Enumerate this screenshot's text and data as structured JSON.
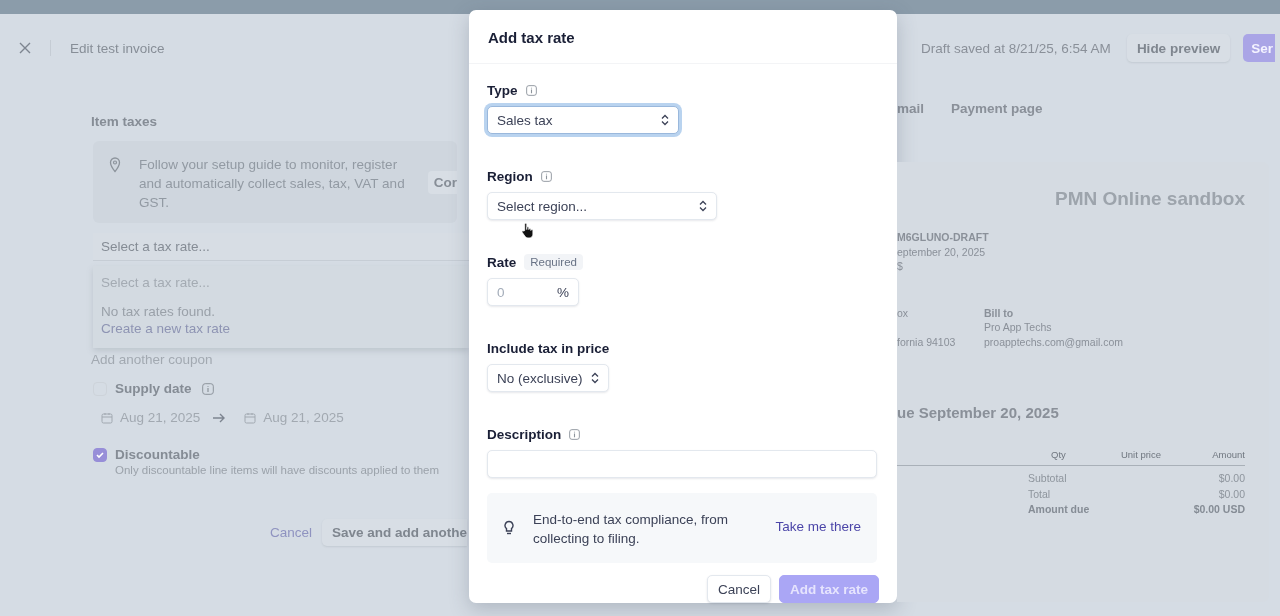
{
  "header": {
    "title": "Edit test invoice",
    "draft_status": "Draft saved at 8/21/25, 6:54 AM",
    "buttons": [
      {
        "label": "Hide preview",
        "kind": "secondary"
      },
      {
        "label": "Ser",
        "kind": "primary"
      }
    ]
  },
  "item_form": {
    "section_title": "Item taxes",
    "notice": {
      "text": "Follow your setup guide to monitor, register and automatically collect sales, tax, VAT and GST.",
      "button": "Cor"
    },
    "tax_select": {
      "placeholder": "Select a tax rate..."
    },
    "dropdown": {
      "search_placeholder": "Select a tax rate...",
      "empty_text": "No tax rates found.",
      "create_link": "Create a new tax rate"
    },
    "add_coupon": "Add another coupon",
    "supply_date": {
      "label": "Supply date",
      "checked": false,
      "start": "Aug 21, 2025",
      "end": "Aug 21, 2025"
    },
    "discountable": {
      "label": "Discountable",
      "checked": true,
      "hint": "Only discountable line items will have discounts applied to them"
    },
    "actions": {
      "cancel": "Cancel",
      "save": "Save and add anothe"
    }
  },
  "dialog": {
    "title": "Add tax rate",
    "fields": [
      {
        "kind": "select",
        "label": "Type",
        "info": true,
        "value": "Sales tax",
        "focused": true
      },
      {
        "kind": "select",
        "label": "Region",
        "info": true,
        "value": "Select region...",
        "focused": false
      },
      {
        "kind": "rate",
        "label": "Rate",
        "info": false,
        "badge": "Required",
        "placeholder": "0",
        "suffix": "%"
      },
      {
        "kind": "select",
        "label": "Include tax in price",
        "info": false,
        "value": "No (exclusive)",
        "focused": false
      },
      {
        "kind": "text",
        "label": "Description",
        "info": true
      }
    ],
    "notice": {
      "text": "End-to-end tax compliance, from collecting to filing.",
      "link": "Take me there"
    },
    "buttons": [
      {
        "label": "Cancel",
        "kind": "secondary",
        "disabled": false
      },
      {
        "label": "Add tax rate",
        "kind": "primary",
        "disabled": true
      }
    ]
  },
  "preview": {
    "tabs": [
      "mail",
      "Payment page"
    ],
    "invoice": {
      "company": "PMN Online sandbox",
      "meta": [
        "M6GLUNO-DRAFT",
        "eptember 20, 2025",
        "$"
      ],
      "from_lines": [
        "ox",
        "fornia 94103"
      ],
      "bill_to": {
        "label": "Bill to",
        "lines": [
          "Pro App Techs",
          "proapptechs.com@gmail.com"
        ]
      },
      "due_heading": "ue September 20, 2025",
      "columns": [
        "Qty",
        "Unit price",
        "Amount"
      ],
      "totals": [
        {
          "label": "Subtotal",
          "value": "$0.00",
          "emphasis": false
        },
        {
          "label": "Total",
          "value": "$0.00",
          "emphasis": false
        },
        {
          "label": "Amount due",
          "value": "$0.00 USD",
          "emphasis": true
        }
      ]
    }
  }
}
